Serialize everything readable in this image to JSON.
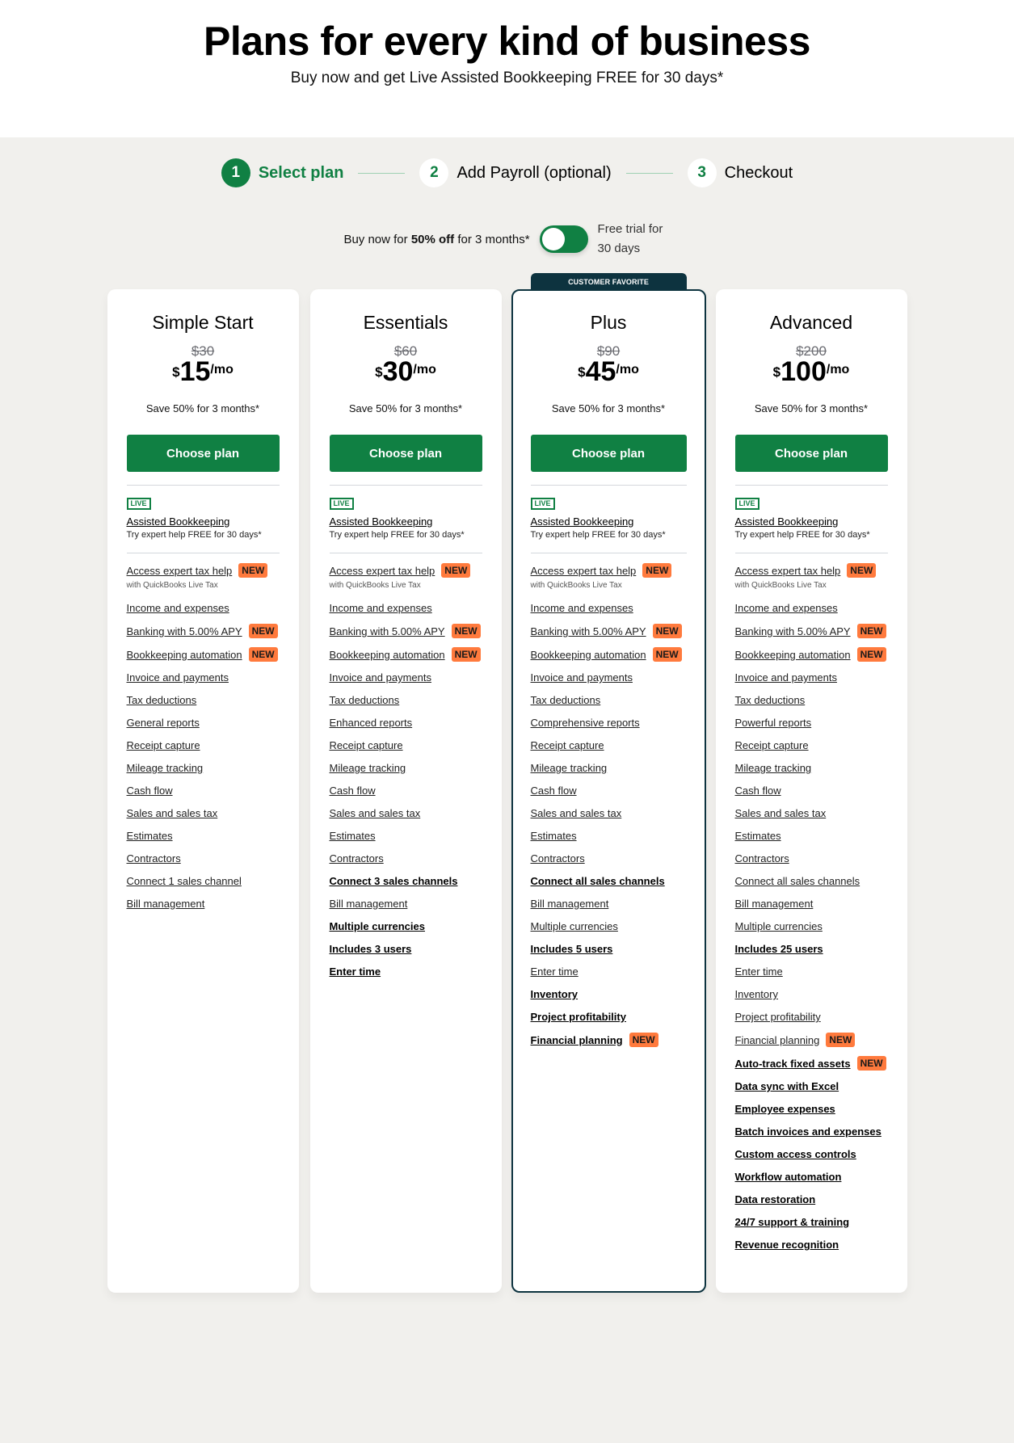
{
  "hero": {
    "title": "Plans for every kind of business",
    "subtitle": "Buy now and get Live Assisted Bookkeeping FREE for 30 days*"
  },
  "stepper": {
    "steps": [
      {
        "num": "1",
        "label": "Select plan",
        "active": true
      },
      {
        "num": "2",
        "label": "Add Payroll (optional)",
        "active": false
      },
      {
        "num": "3",
        "label": "Checkout",
        "active": false
      }
    ]
  },
  "toggle": {
    "left_prefix": "Buy now for ",
    "left_bold": "50% off",
    "left_suffix": " for 3 months*",
    "right_label": "Free trial for 30 days",
    "on": false
  },
  "colors": {
    "brand_green": "#108043",
    "featured_navy": "#0d333f",
    "new_badge": "#ff7a3d",
    "background": "#f1f0ed"
  },
  "common": {
    "choose_label": "Choose plan",
    "live_label": "LIVE",
    "assisted_title": "Assisted Bookkeeping",
    "assisted_sub": "Try expert help FREE for 30 days*",
    "new_label": "NEW",
    "featured_tab": "CUSTOMER FAVORITE"
  },
  "plans": [
    {
      "name": "Simple Start",
      "old_price": "$30",
      "currency": "$",
      "price": "15",
      "per": "/mo",
      "save": "Save 50% for 3 months*",
      "featured": false,
      "features": [
        {
          "label": "Access expert tax help",
          "new": true,
          "sub": "with QuickBooks Live Tax"
        },
        {
          "label": "Income and expenses"
        },
        {
          "label": "Banking with 5.00% APY",
          "new": true
        },
        {
          "label": "Bookkeeping automation",
          "new": true
        },
        {
          "label": "Invoice and payments"
        },
        {
          "label": "Tax deductions"
        },
        {
          "label": "General reports"
        },
        {
          "label": "Receipt capture"
        },
        {
          "label": "Mileage tracking"
        },
        {
          "label": "Cash flow"
        },
        {
          "label": "Sales and sales tax"
        },
        {
          "label": "Estimates"
        },
        {
          "label": "Contractors"
        },
        {
          "label": "Connect 1 sales channel"
        },
        {
          "label": "Bill management"
        }
      ]
    },
    {
      "name": "Essentials",
      "old_price": "$60",
      "currency": "$",
      "price": "30",
      "per": "/mo",
      "save": "Save 50% for 3 months*",
      "featured": false,
      "features": [
        {
          "label": "Access expert tax help",
          "new": true,
          "sub": "with QuickBooks Live Tax"
        },
        {
          "label": "Income and expenses"
        },
        {
          "label": "Banking with 5.00% APY",
          "new": true
        },
        {
          "label": "Bookkeeping automation",
          "new": true
        },
        {
          "label": "Invoice and payments"
        },
        {
          "label": "Tax deductions"
        },
        {
          "label": "Enhanced reports"
        },
        {
          "label": "Receipt capture"
        },
        {
          "label": "Mileage tracking"
        },
        {
          "label": "Cash flow"
        },
        {
          "label": "Sales and sales tax"
        },
        {
          "label": "Estimates"
        },
        {
          "label": "Contractors"
        },
        {
          "label": "Connect 3 sales channels",
          "bold": true
        },
        {
          "label": "Bill management"
        },
        {
          "label": "Multiple currencies",
          "bold": true
        },
        {
          "label": "Includes 3 users",
          "bold": true
        },
        {
          "label": "Enter time",
          "bold": true
        }
      ]
    },
    {
      "name": "Plus",
      "old_price": "$90",
      "currency": "$",
      "price": "45",
      "per": "/mo",
      "save": "Save 50% for 3 months*",
      "featured": true,
      "features": [
        {
          "label": "Access expert tax help",
          "new": true,
          "sub": "with QuickBooks Live Tax"
        },
        {
          "label": "Income and expenses"
        },
        {
          "label": "Banking with 5.00% APY",
          "new": true
        },
        {
          "label": "Bookkeeping automation",
          "new": true
        },
        {
          "label": "Invoice and payments"
        },
        {
          "label": "Tax deductions"
        },
        {
          "label": "Comprehensive reports"
        },
        {
          "label": "Receipt capture"
        },
        {
          "label": "Mileage tracking"
        },
        {
          "label": "Cash flow"
        },
        {
          "label": "Sales and sales tax"
        },
        {
          "label": "Estimates"
        },
        {
          "label": "Contractors"
        },
        {
          "label": "Connect all sales channels",
          "bold": true
        },
        {
          "label": "Bill management"
        },
        {
          "label": "Multiple currencies"
        },
        {
          "label": "Includes 5 users",
          "bold": true
        },
        {
          "label": "Enter time"
        },
        {
          "label": "Inventory",
          "bold": true
        },
        {
          "label": "Project profitability",
          "bold": true
        },
        {
          "label": "Financial planning",
          "bold": true,
          "new": true
        }
      ]
    },
    {
      "name": "Advanced",
      "old_price": "$200",
      "currency": "$",
      "price": "100",
      "per": "/mo",
      "save": "Save 50% for 3 months*",
      "featured": false,
      "features": [
        {
          "label": "Access expert tax help",
          "new": true,
          "sub": "with QuickBooks Live Tax"
        },
        {
          "label": "Income and expenses"
        },
        {
          "label": "Banking with 5.00% APY",
          "new": true
        },
        {
          "label": "Bookkeeping automation",
          "new": true
        },
        {
          "label": "Invoice and payments"
        },
        {
          "label": "Tax deductions"
        },
        {
          "label": "Powerful reports"
        },
        {
          "label": "Receipt capture"
        },
        {
          "label": "Mileage tracking"
        },
        {
          "label": "Cash flow"
        },
        {
          "label": "Sales and sales tax"
        },
        {
          "label": "Estimates"
        },
        {
          "label": "Contractors"
        },
        {
          "label": "Connect all sales channels"
        },
        {
          "label": "Bill management"
        },
        {
          "label": "Multiple currencies"
        },
        {
          "label": "Includes 25 users",
          "bold": true
        },
        {
          "label": "Enter time"
        },
        {
          "label": "Inventory"
        },
        {
          "label": "Project profitability"
        },
        {
          "label": "Financial planning",
          "new": true
        },
        {
          "label": "Auto-track fixed assets",
          "bold": true,
          "new": true
        },
        {
          "label": "Data sync with Excel",
          "bold": true
        },
        {
          "label": "Employee expenses",
          "bold": true
        },
        {
          "label": "Batch invoices and expenses",
          "bold": true
        },
        {
          "label": "Custom access controls",
          "bold": true
        },
        {
          "label": "Workflow automation",
          "bold": true
        },
        {
          "label": "Data restoration",
          "bold": true
        },
        {
          "label": "24/7 support & training",
          "bold": true
        },
        {
          "label": "Revenue recognition",
          "bold": true
        }
      ]
    }
  ]
}
